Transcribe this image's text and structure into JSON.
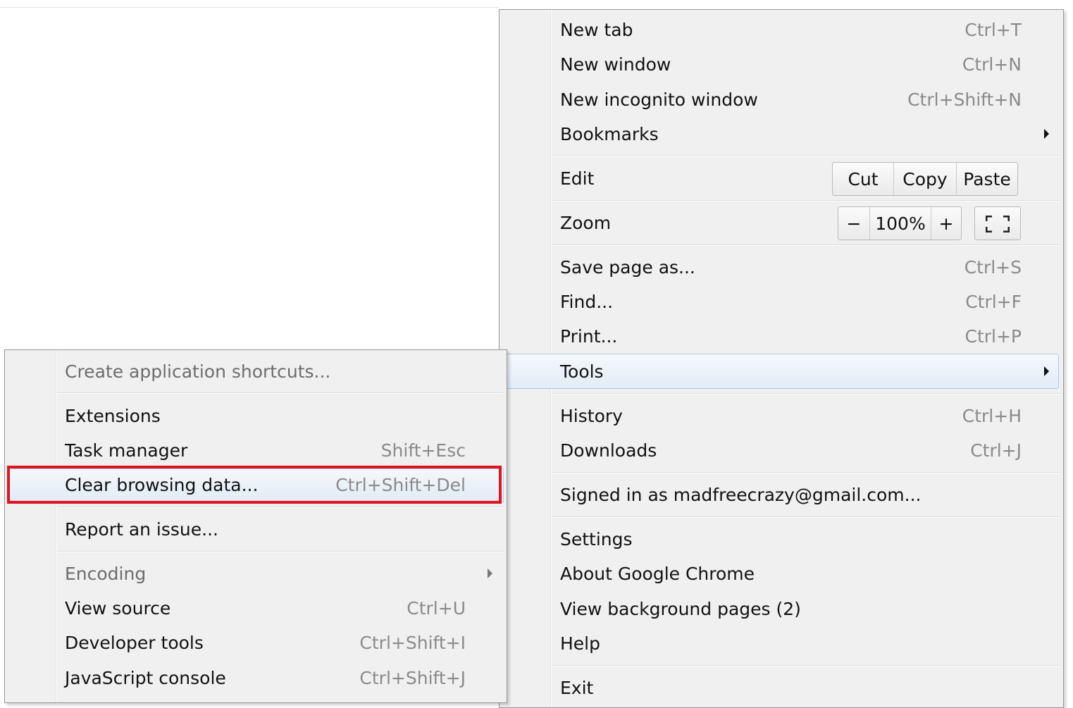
{
  "main_menu": {
    "items": [
      {
        "label": "New tab",
        "shortcut": "Ctrl+T"
      },
      {
        "label": "New window",
        "shortcut": "Ctrl+N"
      },
      {
        "label": "New incognito window",
        "shortcut": "Ctrl+Shift+N"
      },
      {
        "label": "Bookmarks",
        "shortcut": ""
      },
      {
        "label": "Edit",
        "shortcut": ""
      },
      {
        "label": "Zoom",
        "shortcut": ""
      },
      {
        "label": "Save page as...",
        "shortcut": "Ctrl+S"
      },
      {
        "label": "Find...",
        "shortcut": "Ctrl+F"
      },
      {
        "label": "Print...",
        "shortcut": "Ctrl+P"
      },
      {
        "label": "Tools",
        "shortcut": ""
      },
      {
        "label": "History",
        "shortcut": "Ctrl+H"
      },
      {
        "label": "Downloads",
        "shortcut": "Ctrl+J"
      },
      {
        "label": "Signed in as madfreecrazy@gmail.com...",
        "shortcut": ""
      },
      {
        "label": "Settings",
        "shortcut": ""
      },
      {
        "label": "About Google Chrome",
        "shortcut": ""
      },
      {
        "label": "View background pages (2)",
        "shortcut": ""
      },
      {
        "label": "Help",
        "shortcut": ""
      },
      {
        "label": "Exit",
        "shortcut": ""
      }
    ],
    "edit": {
      "cut": "Cut",
      "copy": "Copy",
      "paste": "Paste"
    },
    "zoom": {
      "minus": "−",
      "level": "100%",
      "plus": "+"
    }
  },
  "tools_submenu": {
    "items": [
      {
        "label": "Create application shortcuts...",
        "shortcut": ""
      },
      {
        "label": "Extensions",
        "shortcut": ""
      },
      {
        "label": "Task manager",
        "shortcut": "Shift+Esc"
      },
      {
        "label": "Clear browsing data...",
        "shortcut": "Ctrl+Shift+Del"
      },
      {
        "label": "Report an issue...",
        "shortcut": ""
      },
      {
        "label": "Encoding",
        "shortcut": ""
      },
      {
        "label": "View source",
        "shortcut": "Ctrl+U"
      },
      {
        "label": "Developer tools",
        "shortcut": "Ctrl+Shift+I"
      },
      {
        "label": "JavaScript console",
        "shortcut": "Ctrl+Shift+J"
      }
    ]
  },
  "icons": {
    "submenu_arrow": "triangle-right-icon",
    "fullscreen": "fullscreen-icon"
  },
  "colors": {
    "highlight_border": "#e0141e",
    "menu_bg": "#f0f0f0",
    "hover_border": "#a8c8ec"
  }
}
